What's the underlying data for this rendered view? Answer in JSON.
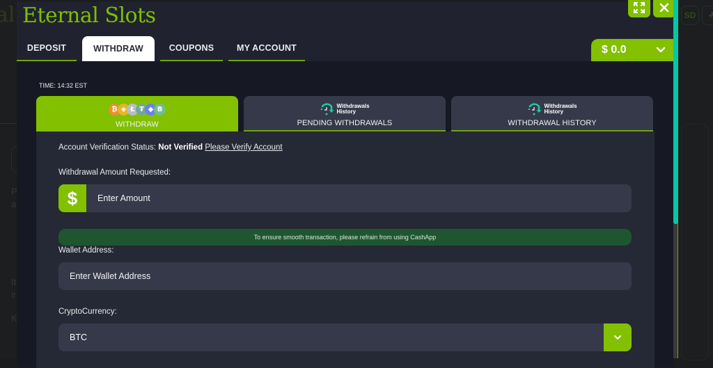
{
  "background": {
    "logo_fragment": "al",
    "left_text_fragments": [
      "P",
      "a",
      "It",
      "ir",
      "K"
    ],
    "right_chips": [
      "SD",
      "☘"
    ]
  },
  "modal": {
    "brand": "Eternal Slots",
    "buttons": {
      "expand_icon": "expand-arrows-icon",
      "close_icon": "close-icon"
    },
    "tabs": [
      {
        "label": "DEPOSIT",
        "active": false
      },
      {
        "label": "WITHDRAW",
        "active": true
      },
      {
        "label": "COUPONS",
        "active": false
      },
      {
        "label": "MY ACCOUNT",
        "active": false
      }
    ],
    "balance": {
      "label": "$ 0.0",
      "icon": "chevron-down-icon"
    },
    "time": "TIME: 14:32 EST",
    "sub_tabs": [
      {
        "label": "WITHDRAW",
        "active": true,
        "icon": "crypto-coins-icon",
        "coins": [
          "₿",
          "◈",
          "Ł",
          "₮",
          "◆",
          "B"
        ]
      },
      {
        "label": "PENDING WITHDRAWALS",
        "active": false,
        "icon": "withdrawals-history-icon",
        "badge_line1": "Withdrawals",
        "badge_line2": "History"
      },
      {
        "label": "WITHDRAWAL HISTORY",
        "active": false,
        "icon": "withdrawals-history-icon",
        "badge_line1": "Withdrawals",
        "badge_line2": "History"
      }
    ],
    "form": {
      "verification_prefix": "Account Verification Status:",
      "verification_status": "Not Verified",
      "verification_link": "Please Verify Account",
      "amount_label": "Withdrawal Amount Requested:",
      "amount_placeholder": "Enter Amount",
      "amount_value": "",
      "amount_icon": "$",
      "notice": "To ensure smooth transaction, please refrain from using CashApp",
      "wallet_label": "Wallet Address:",
      "wallet_placeholder": "Enter Wallet Address",
      "wallet_value": "",
      "crypto_label": "CryptoCurrency:",
      "crypto_selected": "BTC"
    },
    "colors": {
      "accent": "#82c000",
      "scrollbar": "#00c9a7",
      "notice_bg": "#1f5630"
    }
  }
}
